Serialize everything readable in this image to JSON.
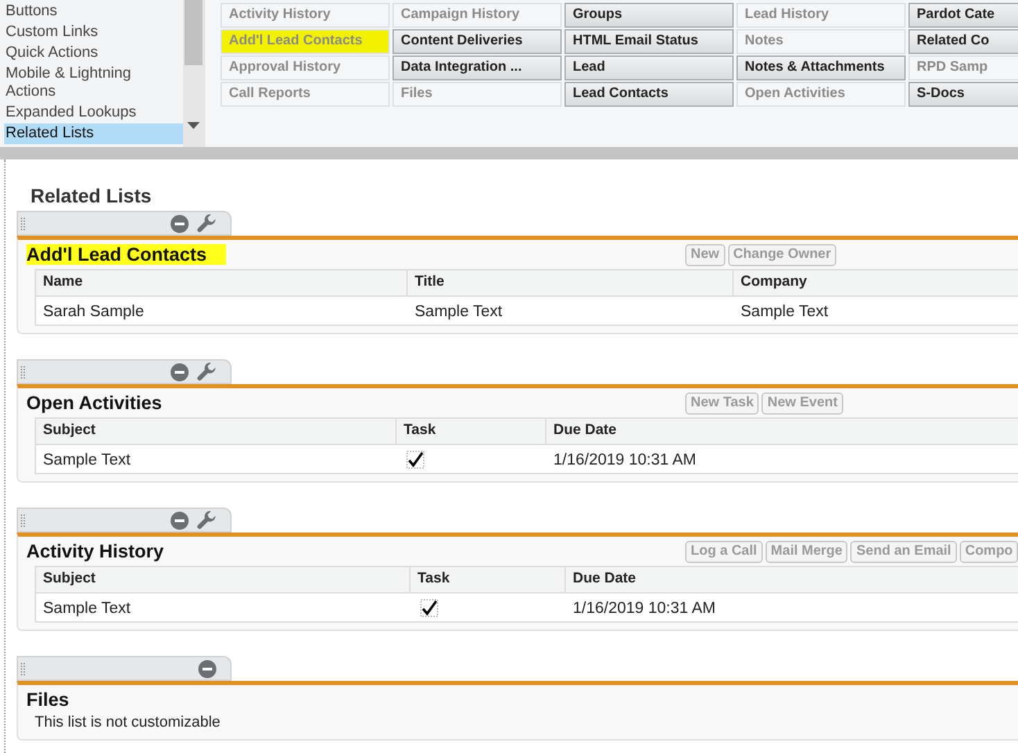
{
  "palette": {
    "sidebar": {
      "items": [
        {
          "label": "Buttons",
          "selected": false
        },
        {
          "label": "Custom Links",
          "selected": false
        },
        {
          "label": "Quick Actions",
          "selected": false
        },
        {
          "label": "Mobile & Lightning Actions",
          "selected": false
        },
        {
          "label": "Expanded Lookups",
          "selected": false
        },
        {
          "label": "Related Lists",
          "selected": true
        }
      ]
    },
    "columns": [
      [
        {
          "label": "Activity History",
          "used": true,
          "highlighted": false
        },
        {
          "label": "Add'l Lead Contacts",
          "used": true,
          "highlighted": true
        },
        {
          "label": "Approval History",
          "used": true,
          "highlighted": false
        },
        {
          "label": "Call Reports",
          "used": true,
          "highlighted": false
        }
      ],
      [
        {
          "label": "Campaign History",
          "used": true,
          "highlighted": false
        },
        {
          "label": "Content Deliveries",
          "used": false,
          "highlighted": false
        },
        {
          "label": "Data Integration ...",
          "used": false,
          "highlighted": false
        },
        {
          "label": "Files",
          "used": true,
          "highlighted": false
        }
      ],
      [
        {
          "label": "Groups",
          "used": false,
          "highlighted": false
        },
        {
          "label": "HTML Email Status",
          "used": false,
          "highlighted": false
        },
        {
          "label": "Lead",
          "used": false,
          "highlighted": false
        },
        {
          "label": "Lead Contacts",
          "used": false,
          "highlighted": false
        }
      ],
      [
        {
          "label": "Lead History",
          "used": true,
          "highlighted": false
        },
        {
          "label": "Notes",
          "used": true,
          "highlighted": false
        },
        {
          "label": "Notes & Attachments",
          "used": false,
          "highlighted": false
        },
        {
          "label": "Open Activities",
          "used": true,
          "highlighted": false
        }
      ],
      [
        {
          "label": "Pardot Cate",
          "used": false,
          "highlighted": false
        },
        {
          "label": "Related Co",
          "used": false,
          "highlighted": false
        },
        {
          "label": "RPD Samp",
          "used": true,
          "highlighted": false
        },
        {
          "label": "S-Docs",
          "used": false,
          "highlighted": false
        }
      ]
    ]
  },
  "page_title": "Related Lists",
  "sections": [
    {
      "title": "Add'l Lead Contacts",
      "highlighted": true,
      "tools": [
        {
          "kind": "minimize"
        },
        {
          "kind": "customize"
        }
      ],
      "buttons": [
        "New",
        "Change Owner"
      ],
      "columns": [
        "Name",
        "Title",
        "Company"
      ],
      "rows": [
        [
          {
            "text": "Sarah Sample"
          },
          {
            "text": "Sample Text"
          },
          {
            "text": "Sample Text"
          }
        ]
      ]
    },
    {
      "title": "Open Activities",
      "highlighted": false,
      "tools": [
        {
          "kind": "minimize"
        },
        {
          "kind": "customize"
        }
      ],
      "buttons": [
        "New Task",
        "New Event"
      ],
      "columns": [
        "Subject",
        "Task",
        "Due Date"
      ],
      "rows": [
        [
          {
            "text": "Sample Text"
          },
          {
            "checked": true
          },
          {
            "text": "1/16/2019 10:31 AM"
          }
        ]
      ]
    },
    {
      "title": "Activity History",
      "highlighted": false,
      "tools": [
        {
          "kind": "minimize"
        },
        {
          "kind": "customize"
        }
      ],
      "buttons": [
        "Log a Call",
        "Mail Merge",
        "Send an Email",
        "Compo"
      ],
      "columns": [
        "Subject",
        "Task",
        "Due Date"
      ],
      "rows": [
        [
          {
            "text": "Sample Text"
          },
          {
            "checked": true
          },
          {
            "text": "1/16/2019 10:31 AM"
          }
        ]
      ]
    },
    {
      "title": "Files",
      "highlighted": false,
      "tools": [
        {
          "kind": "minimize"
        }
      ],
      "note": "This list is not customizable"
    }
  ]
}
